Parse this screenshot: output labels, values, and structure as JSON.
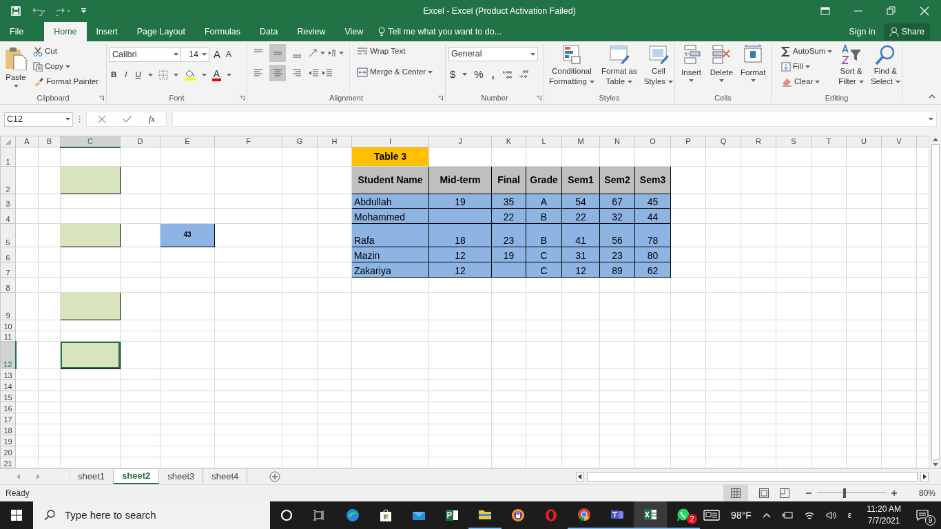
{
  "window": {
    "title": "Excel - Excel (Product Activation Failed)"
  },
  "tabs": [
    {
      "label": "File",
      "selected": false
    },
    {
      "label": "Home",
      "selected": true
    },
    {
      "label": "Insert",
      "selected": false
    },
    {
      "label": "Page Layout",
      "selected": false
    },
    {
      "label": "Formulas",
      "selected": false
    },
    {
      "label": "Data",
      "selected": false
    },
    {
      "label": "Review",
      "selected": false
    },
    {
      "label": "View",
      "selected": false
    }
  ],
  "tell_me": {
    "placeholder": "Tell me what you want to do..."
  },
  "account": {
    "sign_in": "Sign in",
    "share": "Share"
  },
  "ribbon": {
    "clipboard": {
      "label": "Clipboard",
      "paste": "Paste",
      "cut": "Cut",
      "copy": "Copy",
      "format_painter": "Format Painter"
    },
    "font": {
      "label": "Font",
      "name": "Calibri",
      "size": "14",
      "grow": "A",
      "shrink": "A",
      "bold": "B",
      "italic": "I",
      "underline": "U",
      "color_letter": "A"
    },
    "alignment": {
      "label": "Alignment",
      "wrap": "Wrap Text",
      "merge": "Merge & Center",
      "vertical": [
        {
          "selected": false
        },
        {
          "selected": true
        },
        {
          "selected": false
        }
      ],
      "horizontal": [
        {
          "selected": false
        },
        {
          "selected": true
        },
        {
          "selected": false
        }
      ]
    },
    "number": {
      "label": "Number",
      "format": "General",
      "currency": "$",
      "percent": "%",
      "comma": ","
    },
    "styles": {
      "label": "Styles",
      "buttons": [
        {
          "lines": [
            "Conditional",
            "Formatting"
          ]
        },
        {
          "lines": [
            "Format as",
            "Table"
          ]
        },
        {
          "lines": [
            "Cell",
            "Styles"
          ]
        }
      ]
    },
    "cells": {
      "label": "Cells",
      "buttons": [
        "Insert",
        "Delete",
        "Format"
      ]
    },
    "editing": {
      "label": "Editing",
      "autosum": "AutoSum",
      "fill": "Fill",
      "clear": "Clear",
      "sort": [
        "Sort &",
        "Filter"
      ],
      "find": [
        "Find &",
        "Select"
      ]
    }
  },
  "formula_bar": {
    "name_box": "C12",
    "fx": "fx"
  },
  "grid": {
    "columns": [
      {
        "label": "A",
        "selected": false
      },
      {
        "label": "B",
        "selected": false
      },
      {
        "label": "C",
        "selected": true
      },
      {
        "label": "D",
        "selected": false
      },
      {
        "label": "E",
        "selected": false
      },
      {
        "label": "F",
        "selected": false
      },
      {
        "label": "G",
        "selected": false
      },
      {
        "label": "H",
        "selected": false
      },
      {
        "label": "I",
        "selected": false
      },
      {
        "label": "J",
        "selected": false
      },
      {
        "label": "K",
        "selected": false
      },
      {
        "label": "L",
        "selected": false
      },
      {
        "label": "M",
        "selected": false
      },
      {
        "label": "N",
        "selected": false
      },
      {
        "label": "O",
        "selected": false
      },
      {
        "label": "P",
        "selected": false
      },
      {
        "label": "Q",
        "selected": false
      },
      {
        "label": "R",
        "selected": false
      },
      {
        "label": "S",
        "selected": false
      },
      {
        "label": "T",
        "selected": false
      },
      {
        "label": "U",
        "selected": false
      },
      {
        "label": "V",
        "selected": false
      }
    ],
    "rows": [
      {
        "label": "1",
        "selected": false,
        "cells": {
          "I": {
            "kind": "title",
            "text": "Table 3"
          }
        }
      },
      {
        "label": "2",
        "selected": false,
        "cells": {
          "C": {
            "kind": "box",
            "selected": false
          },
          "I": {
            "kind": "header",
            "text": "Student Name"
          },
          "J": {
            "kind": "header",
            "text": "Mid-term"
          },
          "K": {
            "kind": "header",
            "text": "Final"
          },
          "L": {
            "kind": "header",
            "text": "Grade"
          },
          "M": {
            "kind": "header",
            "text": "Sem1"
          },
          "N": {
            "kind": "header",
            "text": "Sem2"
          },
          "O": {
            "kind": "header",
            "text": "Sem3"
          }
        }
      },
      {
        "label": "3",
        "selected": false,
        "cells": {
          "I": {
            "kind": "name",
            "text": "Abdullah"
          },
          "J": {
            "kind": "value",
            "text": "19"
          },
          "K": {
            "kind": "value",
            "text": "35"
          },
          "L": {
            "kind": "value",
            "text": "A"
          },
          "M": {
            "kind": "value",
            "text": "54"
          },
          "N": {
            "kind": "value",
            "text": "67"
          },
          "O": {
            "kind": "value",
            "text": "45"
          }
        }
      },
      {
        "label": "4",
        "selected": false,
        "cells": {
          "I": {
            "kind": "name",
            "text": "Mohammed"
          },
          "J": {
            "kind": "value"
          },
          "K": {
            "kind": "value",
            "text": "22"
          },
          "L": {
            "kind": "value",
            "text": "B"
          },
          "M": {
            "kind": "value",
            "text": "22"
          },
          "N": {
            "kind": "value",
            "text": "32"
          },
          "O": {
            "kind": "value",
            "text": "44"
          }
        }
      },
      {
        "label": "5",
        "selected": false,
        "cells": {
          "C": {
            "kind": "box",
            "selected": false
          },
          "E": {
            "kind": "note",
            "text": "43"
          },
          "I": {
            "kind": "name",
            "text": "Rafa"
          },
          "J": {
            "kind": "value",
            "text": "18"
          },
          "K": {
            "kind": "value",
            "text": "23"
          },
          "L": {
            "kind": "value",
            "text": "B"
          },
          "M": {
            "kind": "value",
            "text": "41"
          },
          "N": {
            "kind": "value",
            "text": "56"
          },
          "O": {
            "kind": "value",
            "text": "78"
          }
        }
      },
      {
        "label": "6",
        "selected": false,
        "cells": {
          "I": {
            "kind": "name",
            "text": "Mazin"
          },
          "J": {
            "kind": "value",
            "text": "12"
          },
          "K": {
            "kind": "value",
            "text": "19"
          },
          "L": {
            "kind": "value",
            "text": "C"
          },
          "M": {
            "kind": "value",
            "text": "31"
          },
          "N": {
            "kind": "value",
            "text": "23"
          },
          "O": {
            "kind": "value",
            "text": "80"
          }
        }
      },
      {
        "label": "7",
        "selected": false,
        "cells": {
          "I": {
            "kind": "name",
            "text": "Zakariya"
          },
          "J": {
            "kind": "value",
            "text": "12"
          },
          "K": {
            "kind": "value"
          },
          "L": {
            "kind": "value",
            "text": "C"
          },
          "M": {
            "kind": "value",
            "text": "12"
          },
          "N": {
            "kind": "value",
            "text": "89"
          },
          "O": {
            "kind": "value",
            "text": "62"
          }
        }
      },
      {
        "label": "8",
        "selected": false,
        "cells": {}
      },
      {
        "label": "9",
        "selected": false,
        "cells": {
          "C": {
            "kind": "box",
            "selected": false
          }
        }
      },
      {
        "label": "10",
        "selected": false,
        "cells": {}
      },
      {
        "label": "11",
        "selected": false,
        "cells": {}
      },
      {
        "label": "12",
        "selected": true,
        "cells": {
          "C": {
            "kind": "box",
            "selected": true
          }
        }
      },
      {
        "label": "13",
        "selected": false,
        "cells": {}
      },
      {
        "label": "14",
        "selected": false,
        "cells": {}
      },
      {
        "label": "15",
        "selected": false,
        "cells": {}
      },
      {
        "label": "16",
        "selected": false,
        "cells": {}
      },
      {
        "label": "17",
        "selected": false,
        "cells": {}
      },
      {
        "label": "18",
        "selected": false,
        "cells": {}
      },
      {
        "label": "19",
        "selected": false,
        "cells": {}
      },
      {
        "label": "20",
        "selected": false,
        "cells": {}
      },
      {
        "label": "21",
        "selected": false,
        "cells": {}
      }
    ]
  },
  "sheets": [
    {
      "label": "sheet1",
      "selected": false
    },
    {
      "label": "sheet2",
      "selected": true
    },
    {
      "label": "sheet3",
      "selected": false
    },
    {
      "label": "sheet4",
      "selected": false
    }
  ],
  "status_bar": {
    "text": "Ready",
    "zoom": "80%",
    "zoom_level": {
      "level": 0.4
    }
  },
  "taskbar": {
    "search": {
      "placeholder": "Type here to search"
    },
    "apps": [
      {
        "running": false,
        "selected": false
      },
      {
        "running": false,
        "selected": false
      },
      {
        "running": false,
        "selected": false
      },
      {
        "running": false,
        "selected": false
      },
      {
        "running": false,
        "selected": false
      },
      {
        "running": false,
        "selected": false
      },
      {
        "running": true,
        "selected": false
      },
      {
        "running": false,
        "selected": false
      },
      {
        "running": false,
        "selected": false
      },
      {
        "running": true,
        "selected": false
      },
      {
        "running": true,
        "selected": false
      },
      {
        "running": true,
        "selected": true
      },
      {
        "running": true,
        "selected": false,
        "badge": "2"
      }
    ],
    "weather": "98°F",
    "language": "ε",
    "time": "11:20 AM",
    "date": "7/7/2021",
    "notifications": "9"
  }
}
